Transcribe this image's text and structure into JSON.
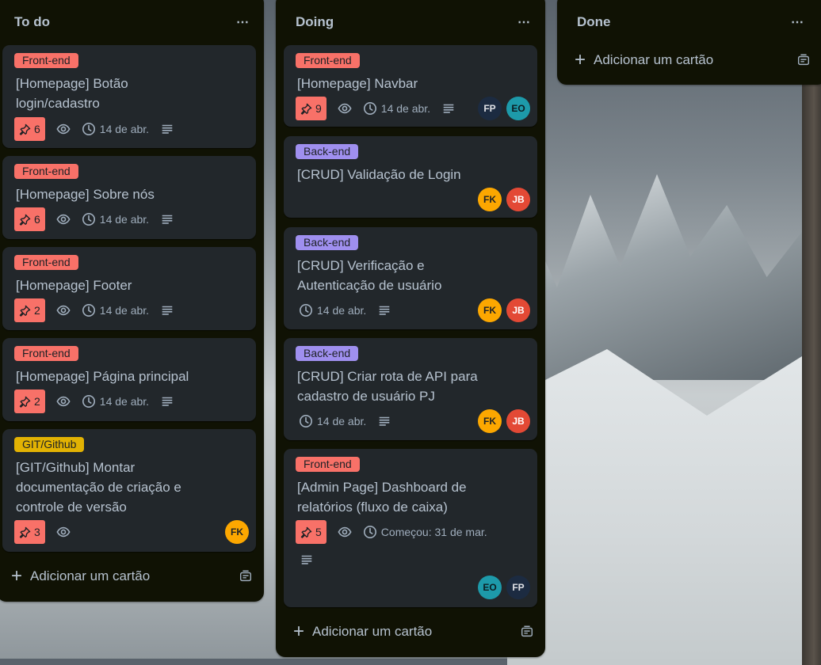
{
  "columns": [
    {
      "title": "To do",
      "menu": "⋯",
      "add_label": "Adicionar um cartão",
      "cards": [
        {
          "label": "Front-end",
          "title": "[Homepage] Botão login/cadastro",
          "votes": "6",
          "date": "14 de abr."
        },
        {
          "label": "Front-end",
          "title": "[Homepage] Sobre nós",
          "votes": "6",
          "date": "14 de abr."
        },
        {
          "label": "Front-end",
          "title": "[Homepage] Footer",
          "votes": "2",
          "date": "14 de abr."
        },
        {
          "label": "Front-end",
          "title": "[Homepage] Página principal",
          "votes": "2",
          "date": "14 de abr."
        },
        {
          "label": "GIT/Github",
          "title": "[GIT/Github] Montar documentação de criação e controle de versão",
          "votes": "3",
          "avatars": [
            "FK"
          ]
        }
      ]
    },
    {
      "title": "Doing",
      "menu": "⋯",
      "add_label": "Adicionar um cartão",
      "cards": [
        {
          "label": "Front-end",
          "title": "[Homepage] Navbar",
          "votes": "9",
          "date": "14 de abr.",
          "avatars": [
            "FP",
            "EO"
          ]
        },
        {
          "label": "Back-end",
          "title": "[CRUD] Validação de Login",
          "avatars": [
            "FK",
            "JB"
          ]
        },
        {
          "label": "Back-end",
          "title": "[CRUD] Verificação e Autenticação de usuário",
          "date": "14 de abr.",
          "avatars": [
            "FK",
            "JB"
          ]
        },
        {
          "label": "Back-end",
          "title": "[CRUD] Criar rota de API para cadastro de usuário PJ",
          "date": "14 de abr.",
          "avatars": [
            "FK",
            "JB"
          ]
        },
        {
          "label": "Front-end",
          "title": "[Admin Page] Dashboard de relatórios (fluxo de caixa)",
          "votes": "5",
          "date": "Começou: 31 de mar.",
          "avatars": [
            "EO",
            "FP"
          ]
        }
      ]
    },
    {
      "title": "Done",
      "menu": "⋯",
      "add_label": "Adicionar um cartão",
      "cards": []
    }
  ],
  "colors": {
    "front_end": "#f87168",
    "back_end": "#9f8fef",
    "git": "#e2b203"
  }
}
